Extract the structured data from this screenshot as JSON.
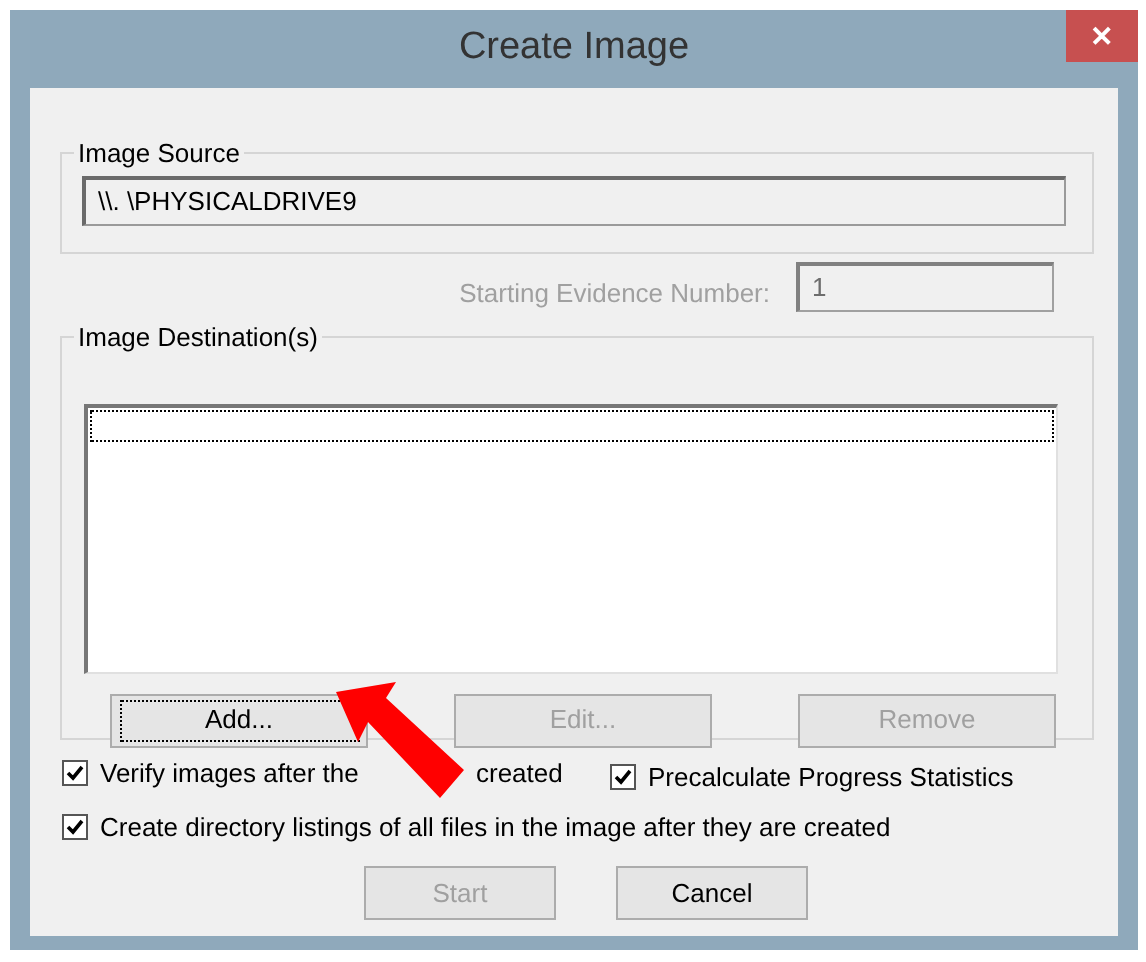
{
  "window": {
    "title": "Create Image",
    "close": "✕"
  },
  "image_source": {
    "label": "Image Source",
    "value": "\\\\. \\PHYSICALDRIVE9"
  },
  "evidence": {
    "label": "Starting Evidence Number:",
    "value": "1",
    "disabled": true
  },
  "destinations": {
    "label": "Image Destination(s)",
    "focused_row": true
  },
  "list_buttons": [
    {
      "label": "Add...",
      "disabled": false,
      "focused": true
    },
    {
      "label": "Edit...",
      "disabled": true,
      "focused": false
    },
    {
      "label": "Remove",
      "disabled": true,
      "focused": false
    }
  ],
  "options": [
    {
      "parts": [
        "Verify images after the",
        "created"
      ],
      "checked": true
    },
    {
      "parts": [
        "Precalculate Progress Statistics"
      ],
      "checked": true
    },
    {
      "parts": [
        "Create directory listings of all files in the image after they are created"
      ],
      "checked": true
    }
  ],
  "buttons": [
    {
      "label": "Start",
      "disabled": true
    },
    {
      "label": "Cancel",
      "disabled": false
    }
  ],
  "annotation": {
    "kind": "arrow"
  }
}
